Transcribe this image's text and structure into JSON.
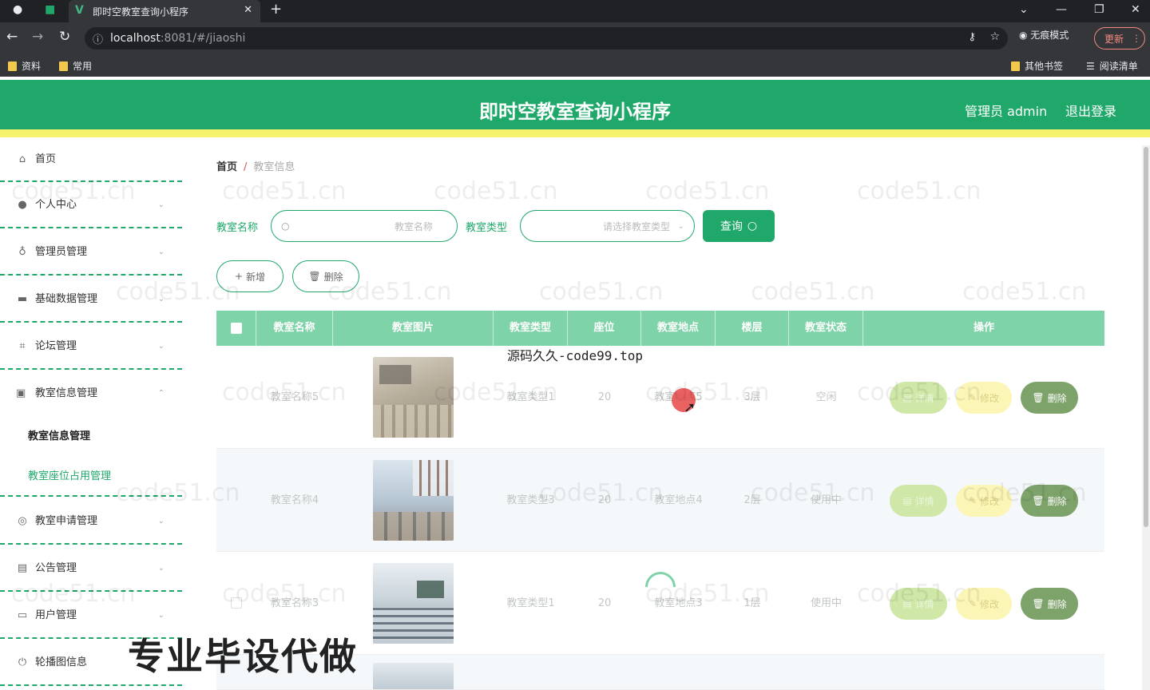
{
  "browser": {
    "tab_title": "即时空教室查询小程序",
    "url_host": "localhost",
    "url_rest": ":8081/#/jiaoshi",
    "incognito_label": "无痕模式",
    "update_label": "更新",
    "bookmarks": [
      "资料",
      "常用"
    ],
    "other_bookmarks": "其他书签",
    "reading_list": "阅读清单"
  },
  "header": {
    "title": "即时空教室查询小程序",
    "user": "管理员 admin",
    "logout": "退出登录",
    "bg_color": "#1fa86a",
    "accent_color": "#f5f26c"
  },
  "sidebar": {
    "items": [
      {
        "label": "首页",
        "icon": "home-icon"
      },
      {
        "label": "个人中心",
        "icon": "user-icon"
      },
      {
        "label": "管理员管理",
        "icon": "mic-icon"
      },
      {
        "label": "基础数据管理",
        "icon": "briefcase-icon"
      },
      {
        "label": "论坛管理",
        "icon": "crop-icon"
      },
      {
        "label": "教室信息管理",
        "icon": "chat-icon"
      },
      {
        "label": "教室申请管理",
        "icon": "compass-icon"
      },
      {
        "label": "公告管理",
        "icon": "ticket-icon"
      },
      {
        "label": "用户管理",
        "icon": "monitor-icon"
      },
      {
        "label": "轮播图信息",
        "icon": "power-icon"
      }
    ],
    "sub_items": [
      "教室信息管理",
      "教室座位占用管理"
    ]
  },
  "breadcrumb": {
    "home": "首页",
    "separator": "/",
    "current": "教室信息"
  },
  "filters": {
    "name_label": "教室名称",
    "name_placeholder": "教室名称",
    "type_label": "教室类型",
    "type_placeholder": "请选择教室类型",
    "query_button": "查询"
  },
  "actions": {
    "add": "新增",
    "delete": "删除"
  },
  "table": {
    "columns": [
      "教室名称",
      "教室图片",
      "教室类型",
      "座位",
      "教室地点",
      "楼层",
      "教室状态",
      "操作"
    ],
    "rows": [
      {
        "name": "教室名称5",
        "type": "教室类型1",
        "seats": "20",
        "location": "教室地点5",
        "floor": "3层",
        "status": "空闲"
      },
      {
        "name": "教室名称4",
        "type": "教室类型3",
        "seats": "20",
        "location": "教室地点4",
        "floor": "2层",
        "status": "使用中"
      },
      {
        "name": "教室名称3",
        "type": "教室类型1",
        "seats": "20",
        "location": "教室地点3",
        "floor": "1层",
        "status": "使用中"
      }
    ],
    "row_actions": {
      "detail": "详情",
      "edit": "修改",
      "delete": "删除"
    }
  },
  "overlays": {
    "source_text": "源码久久-code99.top",
    "banner": "专业毕设代做",
    "watermark": "code51.cn"
  }
}
